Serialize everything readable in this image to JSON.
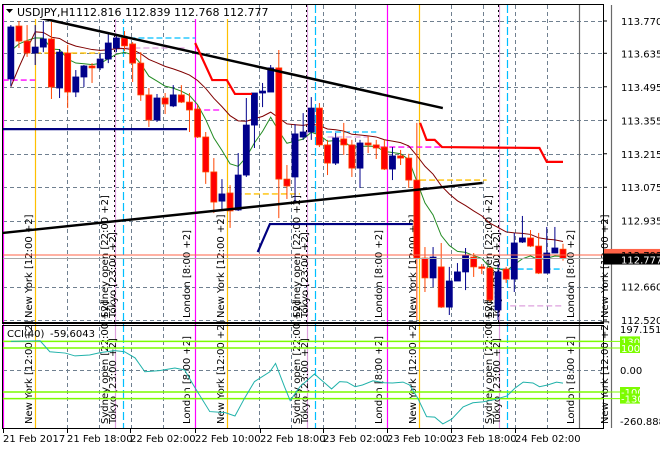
{
  "header": {
    "symbol": "USDJPY,H1",
    "ohlc": "112.816 112.839 112.768 112.777"
  },
  "indicator": {
    "label": "CCI(40)",
    "value": "-59.6043",
    "axis_max": "197.1516",
    "axis_zero": "0.00",
    "axis_min": "-260.8886",
    "levels": [
      "130",
      "100",
      "-100",
      "-130"
    ],
    "level_values": [
      130,
      100,
      -100,
      -130
    ],
    "level_color": "#7cfc00",
    "line_color": "#20b2aa"
  },
  "price_axis": {
    "ticks": [
      "113.770",
      "113.635",
      "113.495",
      "113.355",
      "113.215",
      "113.075",
      "112.935",
      "112.660",
      "112.520"
    ],
    "bid_label": "112.777",
    "ask_label": "112.792"
  },
  "time_axis": {
    "ticks": [
      "21 Feb 2017",
      "21 Feb 18:00",
      "22 Feb 02:00",
      "22 Feb 10:00",
      "22 Feb 18:00",
      "23 Feb 02:00",
      "23 Feb 10:00",
      "23 Feb 18:00",
      "24 Feb 02:00"
    ]
  },
  "sessions": {
    "new_york": "New York  [12:00  +2]",
    "sydney": "Sydney open  [22:00  +2]",
    "tokyo": "Tokyo  [23:00  +2]",
    "london": "London  [8:00  +2]"
  },
  "colors": {
    "bull": "#00008b",
    "bear": "#ff0000",
    "ma_fast": "#228b22",
    "ma_slow": "#800000",
    "trendline": "#000000",
    "new_york": "#ffc000",
    "sydney": "#dda0dd",
    "tokyo": "#00bfff",
    "london": "#ff00ff"
  },
  "chart_data": {
    "type": "candlestick",
    "title": "USDJPY,H1",
    "ylim": [
      112.52,
      113.77
    ],
    "ohlc": [
      [
        113.528,
        113.753,
        113.498,
        113.745
      ],
      [
        113.749,
        113.77,
        113.657,
        113.686
      ],
      [
        113.686,
        113.753,
        113.62,
        113.636
      ],
      [
        113.636,
        113.753,
        113.586,
        113.661
      ],
      [
        113.661,
        113.77,
        113.64,
        113.695
      ],
      [
        113.695,
        113.766,
        113.444,
        113.494
      ],
      [
        113.49,
        113.653,
        113.448,
        113.64
      ],
      [
        113.636,
        113.67,
        113.406,
        113.473
      ],
      [
        113.473,
        113.565,
        113.452,
        113.536
      ],
      [
        113.536,
        113.586,
        113.494,
        113.582
      ],
      [
        113.582,
        113.594,
        113.511,
        113.574
      ],
      [
        113.574,
        113.636,
        113.565,
        113.611
      ],
      [
        113.611,
        113.72,
        113.594,
        113.678
      ],
      [
        113.657,
        113.707,
        113.64,
        113.699
      ],
      [
        113.699,
        113.728,
        113.645,
        113.666
      ],
      [
        113.674,
        113.682,
        113.515,
        113.594
      ],
      [
        113.594,
        113.64,
        113.436,
        113.461
      ],
      [
        113.461,
        113.49,
        113.327,
        113.356
      ],
      [
        113.356,
        113.465,
        113.348,
        113.448
      ],
      [
        113.448,
        113.469,
        113.381,
        113.423
      ],
      [
        113.415,
        113.502,
        113.41,
        113.461
      ],
      [
        113.461,
        113.502,
        113.427,
        113.431
      ],
      [
        113.431,
        113.469,
        113.306,
        113.398
      ],
      [
        113.402,
        113.419,
        113.281,
        113.285
      ],
      [
        113.285,
        113.306,
        113.089,
        113.139
      ],
      [
        113.139,
        113.197,
        112.967,
        113.013
      ],
      [
        113.017,
        113.109,
        112.976,
        113.047
      ],
      [
        113.051,
        113.084,
        112.905,
        112.976
      ],
      [
        112.98,
        113.218,
        112.976,
        113.126
      ],
      [
        113.126,
        113.448,
        113.118,
        113.335
      ],
      [
        113.335,
        113.469,
        113.239,
        113.469
      ],
      [
        113.469,
        113.511,
        113.41,
        113.477
      ],
      [
        113.473,
        113.586,
        113.473,
        113.574
      ],
      [
        113.574,
        113.649,
        112.946,
        113.109
      ],
      [
        113.109,
        113.168,
        113.026,
        113.08
      ],
      [
        113.118,
        113.339,
        113.013,
        113.298
      ],
      [
        113.285,
        113.385,
        113.273,
        113.306
      ],
      [
        113.306,
        113.452,
        113.273,
        113.406
      ],
      [
        113.406,
        113.427,
        113.243,
        113.252
      ],
      [
        113.252,
        113.273,
        113.126,
        113.176
      ],
      [
        113.176,
        113.302,
        113.168,
        113.281
      ],
      [
        113.277,
        113.344,
        113.21,
        113.252
      ],
      [
        113.252,
        113.273,
        113.118,
        113.155
      ],
      [
        113.155,
        113.273,
        113.072,
        113.26
      ],
      [
        113.26,
        113.289,
        113.218,
        113.252
      ],
      [
        113.252,
        113.273,
        113.193,
        113.239
      ],
      [
        113.243,
        113.273,
        113.147,
        113.151
      ],
      [
        113.151,
        113.243,
        113.105,
        113.206
      ],
      [
        113.206,
        113.231,
        113.168,
        113.197
      ],
      [
        113.197,
        113.215,
        113.072,
        113.105
      ],
      [
        113.105,
        113.344,
        112.52,
        112.779
      ],
      [
        112.779,
        112.825,
        112.637,
        112.696
      ],
      [
        112.696,
        112.825,
        112.658,
        112.783
      ],
      [
        112.742,
        112.842,
        112.57,
        112.574
      ],
      [
        112.574,
        112.742,
        112.541,
        112.683
      ],
      [
        112.683,
        112.758,
        112.683,
        112.721
      ],
      [
        112.721,
        112.821,
        112.645,
        112.788
      ],
      [
        112.783,
        112.8,
        112.7,
        112.742
      ],
      [
        112.742,
        112.754,
        112.712,
        112.737
      ],
      [
        112.737,
        112.742,
        112.595,
        112.604
      ],
      [
        112.562,
        112.754,
        112.52,
        112.721
      ],
      [
        112.733,
        112.742,
        112.675,
        112.691
      ],
      [
        112.691,
        112.884,
        112.637,
        112.842
      ],
      [
        112.846,
        112.955,
        112.842,
        112.863
      ],
      [
        112.863,
        112.896,
        112.825,
        112.829
      ],
      [
        112.829,
        112.884,
        112.712,
        112.716
      ],
      [
        112.716,
        112.909,
        112.716,
        112.8
      ],
      [
        112.8,
        112.909,
        112.8,
        112.821
      ],
      [
        112.816,
        112.839,
        112.768,
        112.777
      ]
    ],
    "cci": [
      [
        0,
        130
      ],
      [
        3.6,
        133
      ],
      [
        4.8,
        83
      ],
      [
        6.7,
        77
      ],
      [
        7.9,
        64
      ],
      [
        9.7,
        68
      ],
      [
        11,
        79
      ],
      [
        12.8,
        88
      ],
      [
        14,
        83
      ],
      [
        15.3,
        55
      ],
      [
        16.5,
        -8
      ],
      [
        18.3,
        -3
      ],
      [
        20.2,
        9
      ],
      [
        21.4,
        0
      ],
      [
        22.7,
        -82
      ],
      [
        24.5,
        -189
      ],
      [
        26.4,
        -194
      ],
      [
        27.6,
        -209
      ],
      [
        28.8,
        -127
      ],
      [
        30,
        -53
      ],
      [
        31.9,
        -8
      ],
      [
        32.6,
        30
      ],
      [
        33.7,
        -76
      ],
      [
        34.4,
        -139
      ],
      [
        35.6,
        -76
      ],
      [
        37.4,
        -18
      ],
      [
        38,
        -38
      ],
      [
        39.5,
        -86
      ],
      [
        40.5,
        -53
      ],
      [
        41.4,
        -55
      ],
      [
        42.4,
        -76
      ],
      [
        43.3,
        -68
      ],
      [
        44.6,
        -49
      ],
      [
        46,
        -58
      ],
      [
        47,
        -59
      ],
      [
        48.3,
        -55
      ],
      [
        49.1,
        -68
      ],
      [
        50.1,
        -127
      ],
      [
        51.2,
        -212
      ],
      [
        52.2,
        -214
      ],
      [
        53.2,
        -245
      ],
      [
        54.3,
        -223
      ],
      [
        55.7,
        -168
      ],
      [
        56.9,
        -149
      ],
      [
        58.1,
        -145
      ],
      [
        59.4,
        -136
      ],
      [
        61.1,
        -118
      ],
      [
        62.1,
        -82
      ],
      [
        63.1,
        -55
      ],
      [
        64.3,
        -59
      ],
      [
        65.1,
        -76
      ],
      [
        66.1,
        -68
      ],
      [
        67.2,
        -55
      ],
      [
        68,
        -59.6043
      ]
    ],
    "trendlines": [
      {
        "points": [
          [
            3.6,
            113.783
          ],
          [
            53.2,
            113.406
          ]
        ],
        "color": "#000000"
      },
      {
        "points": [
          [
            -1,
            112.884
          ],
          [
            58.1,
            113.093
          ]
        ],
        "color": "#000000"
      }
    ],
    "polylines": [
      {
        "points": [
          [
            -1,
            113.318
          ],
          [
            21.7,
            113.318
          ]
        ],
        "color": "#000080"
      },
      {
        "points": [
          [
            30.4,
            112.804
          ],
          [
            31.9,
            112.921
          ],
          [
            49.5,
            112.921
          ]
        ],
        "color": "#000080"
      },
      {
        "points": [
          [
            22.7,
            113.678
          ],
          [
            24.8,
            113.523
          ],
          [
            26.6,
            113.523
          ],
          [
            27.6,
            113.465
          ],
          [
            29.7,
            113.465
          ]
        ],
        "color": "#ff0000"
      },
      {
        "points": [
          [
            50.4,
            113.344
          ],
          [
            51.2,
            113.273
          ],
          [
            52.2,
            113.273
          ],
          [
            53.1,
            113.243
          ],
          [
            65.1,
            113.239
          ],
          [
            66,
            113.181
          ],
          [
            68,
            113.181
          ]
        ],
        "color": "#ff0000"
      }
    ],
    "session_levels": [
      {
        "price": 113.523,
        "from": -1,
        "to": 3,
        "color": "#ff00ff"
      },
      {
        "price": 113.636,
        "from": 3,
        "to": 11,
        "color": "#ffc000"
      },
      {
        "price": 113.699,
        "from": 13.5,
        "to": 22.7,
        "color": "#00bfff"
      },
      {
        "price": 113.657,
        "from": 13,
        "to": 21.4,
        "color": "#dda0dd"
      },
      {
        "price": 113.398,
        "from": 22.7,
        "to": 26,
        "color": "#ff00ff"
      },
      {
        "price": 113.047,
        "from": 26.6,
        "to": 35.6,
        "color": "#ffc000"
      },
      {
        "price": 113.306,
        "from": 37.7,
        "to": 45,
        "color": "#00bfff"
      },
      {
        "price": 113.285,
        "from": 39,
        "to": 44,
        "color": "#dda0dd"
      },
      {
        "price": 113.243,
        "from": 45.5,
        "to": 53,
        "color": "#ff00ff"
      },
      {
        "price": 113.105,
        "from": 50.4,
        "to": 58.6,
        "color": "#ffc000"
      },
      {
        "price": 112.733,
        "from": 60.2,
        "to": 68,
        "color": "#00bfff"
      },
      {
        "price": 112.579,
        "from": 61.5,
        "to": 68,
        "color": "#dda0dd"
      }
    ],
    "ask": 112.792,
    "bid": 112.777
  }
}
